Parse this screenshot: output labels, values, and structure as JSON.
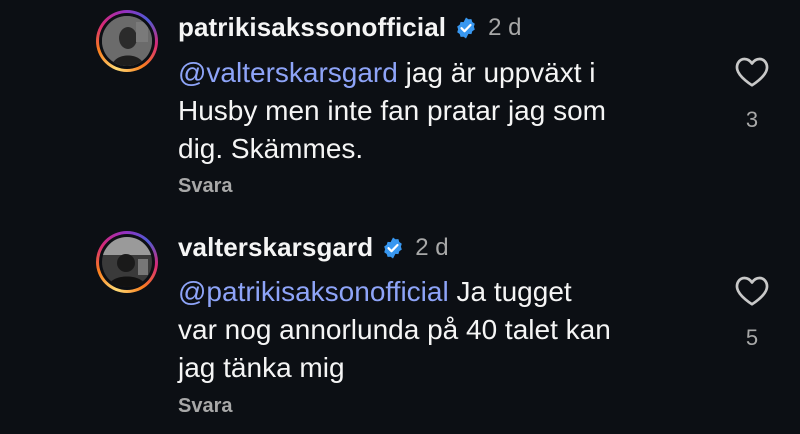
{
  "comments": [
    {
      "username": "patrikisakssonofficial",
      "time": "2 d",
      "mention": "@valterskarsgard",
      "text_lines_after_mention": " jag är uppväxt i",
      "line2": "Husby men inte fan pratar jag som",
      "line3": "dig. Skämmes.",
      "reply_label": "Svara",
      "likes": "3"
    },
    {
      "username": "valterskarsgard",
      "time": "2 d",
      "mention": "@patrikisaksonofficial",
      "text_lines_after_mention": " Ja tugget",
      "line2": "var nog annorlunda på 40 talet kan",
      "line3": "jag tänka mig",
      "reply_label": "Svara",
      "likes": "5"
    }
  ],
  "colors": {
    "background": "#0c0f14",
    "mention": "#8ea4f8",
    "verified": "#3897f0",
    "muted": "#a8a8a8"
  }
}
